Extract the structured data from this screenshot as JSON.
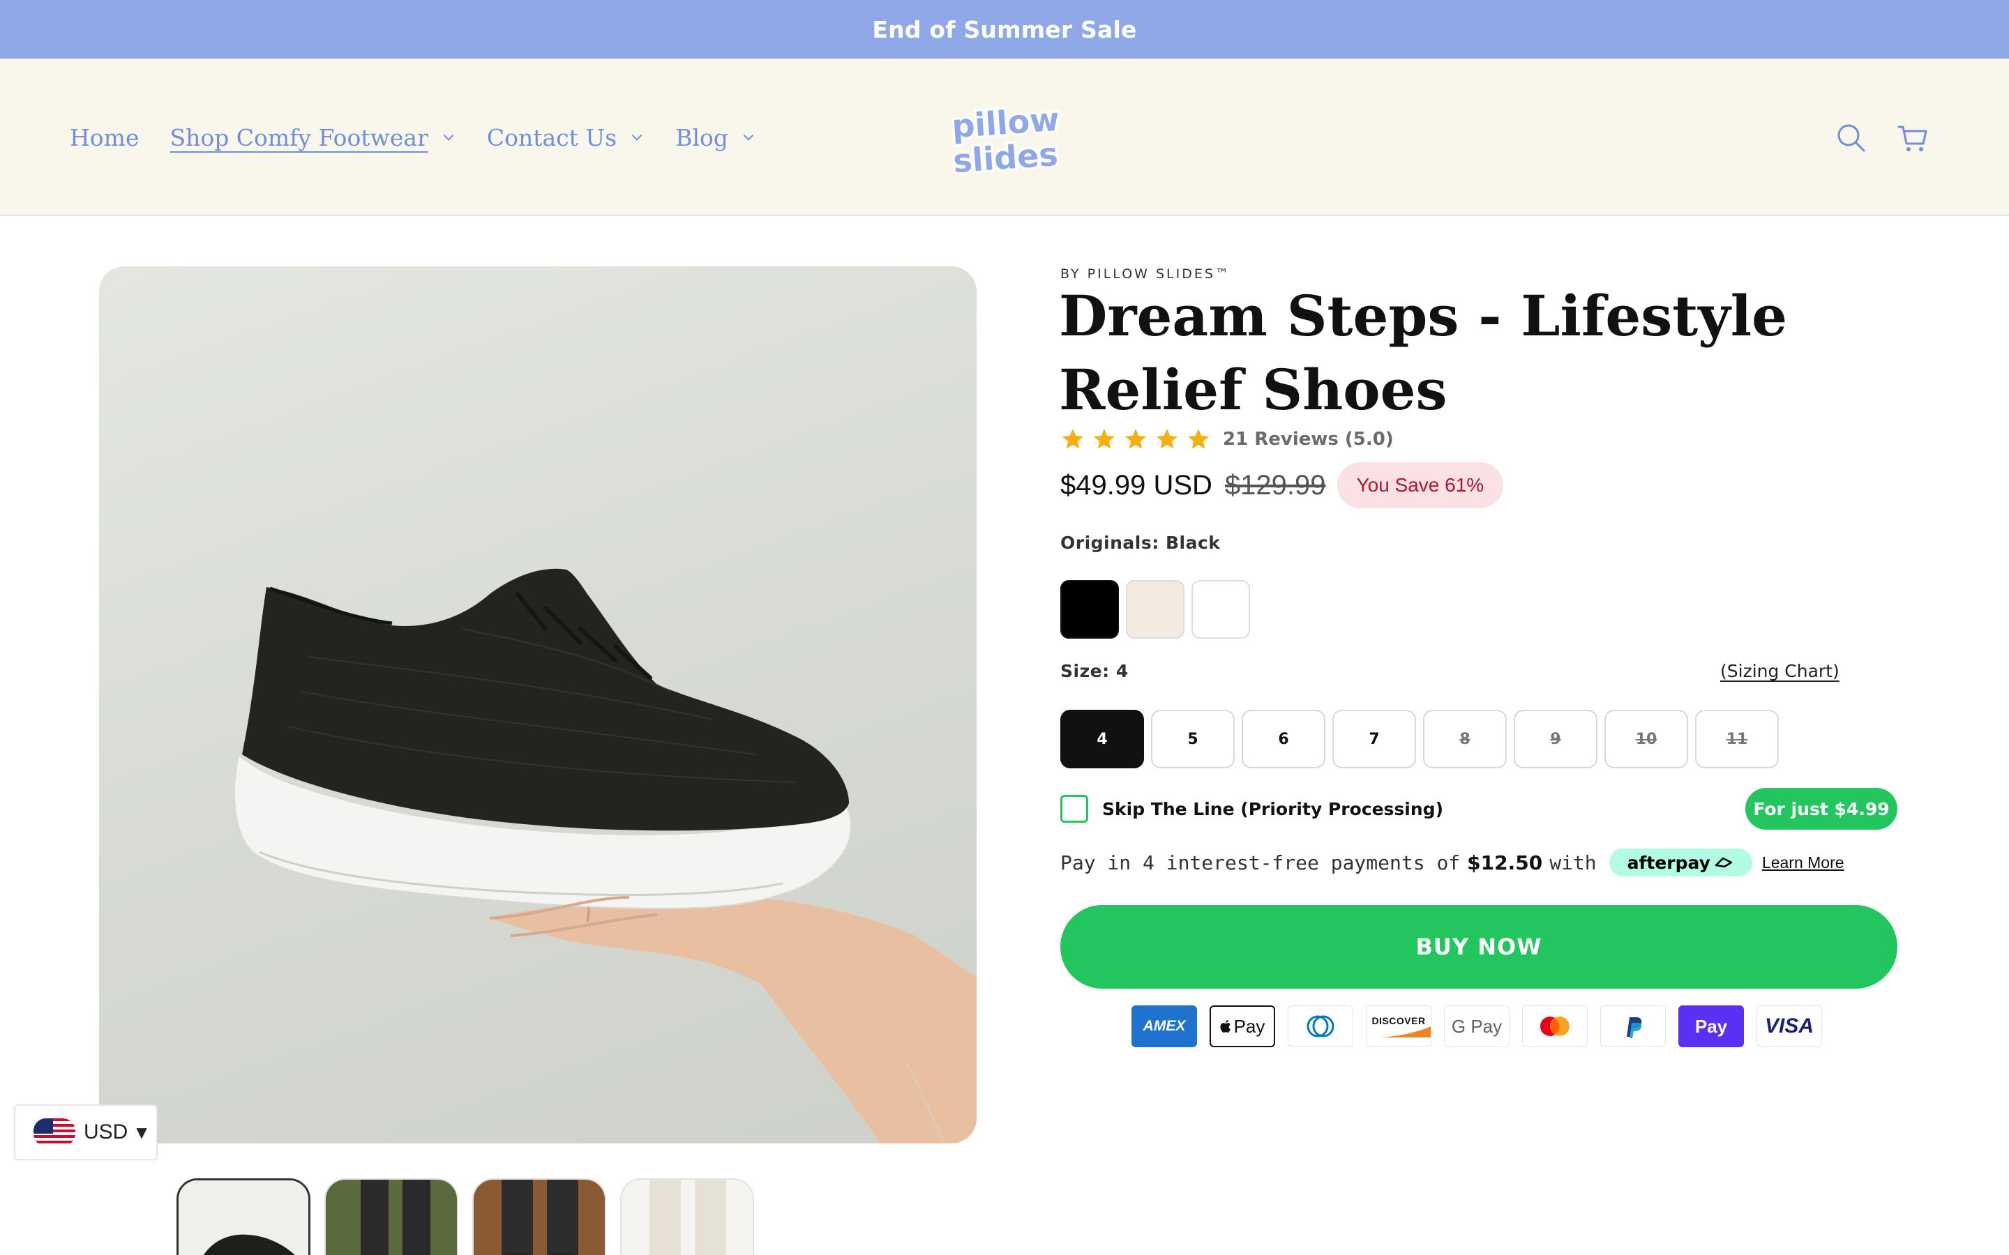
{
  "announcement": {
    "text": "End of Summer Sale"
  },
  "nav": {
    "items": [
      {
        "label": "Home"
      },
      {
        "label": "Shop Comfy Footwear"
      },
      {
        "label": "Contact Us"
      },
      {
        "label": "Blog"
      }
    ]
  },
  "logo": {
    "line1": "pillow",
    "line2": "slides"
  },
  "header_icons": [
    "search-icon",
    "cart-icon"
  ],
  "product": {
    "vendor": "BY PILLOW SLIDES™",
    "title": "Dream Steps - Lifestyle Relief Shoes",
    "rating": {
      "stars": 5,
      "text": "21 Reviews (5.0)"
    },
    "price": "$49.99 USD",
    "compare_price": "$129.99",
    "savings": "You Save 61%",
    "color_option": {
      "label": "Originals:",
      "value": "Black",
      "swatches": [
        "#000000",
        "#f3ebe0",
        "#ffffff"
      ]
    },
    "size_option": {
      "label": "Size:",
      "value": "4",
      "sizing_chart": "(Sizing Chart)",
      "sizes": [
        "4",
        "5",
        "6",
        "7",
        "8",
        "9",
        "10",
        "11"
      ]
    },
    "skip_line": {
      "label": "Skip The Line (Priority Processing)",
      "price_badge": "For just $4.99"
    },
    "afterpay": {
      "prefix": "Pay in 4 interest-free payments of",
      "amount": "$12.50",
      "suffix": "with",
      "brand": "afterpay",
      "learn_more": "Learn More"
    },
    "buy_button": "BUY NOW",
    "payment_methods": [
      "AMEX",
      "Pay",
      "Diners",
      "DISCOVER",
      "G Pay",
      "Mastercard",
      "PayPal",
      "Pay",
      "VISA"
    ]
  },
  "currency": {
    "code": "USD"
  },
  "colors": {
    "accent_blue": "#8fa9e8",
    "nav_blue": "#6f8fd8",
    "green": "#22c55e",
    "cream": "#f9f6ec",
    "star": "#f5b014",
    "save_bg": "#f9e1e4",
    "save_text": "#b0172b"
  }
}
